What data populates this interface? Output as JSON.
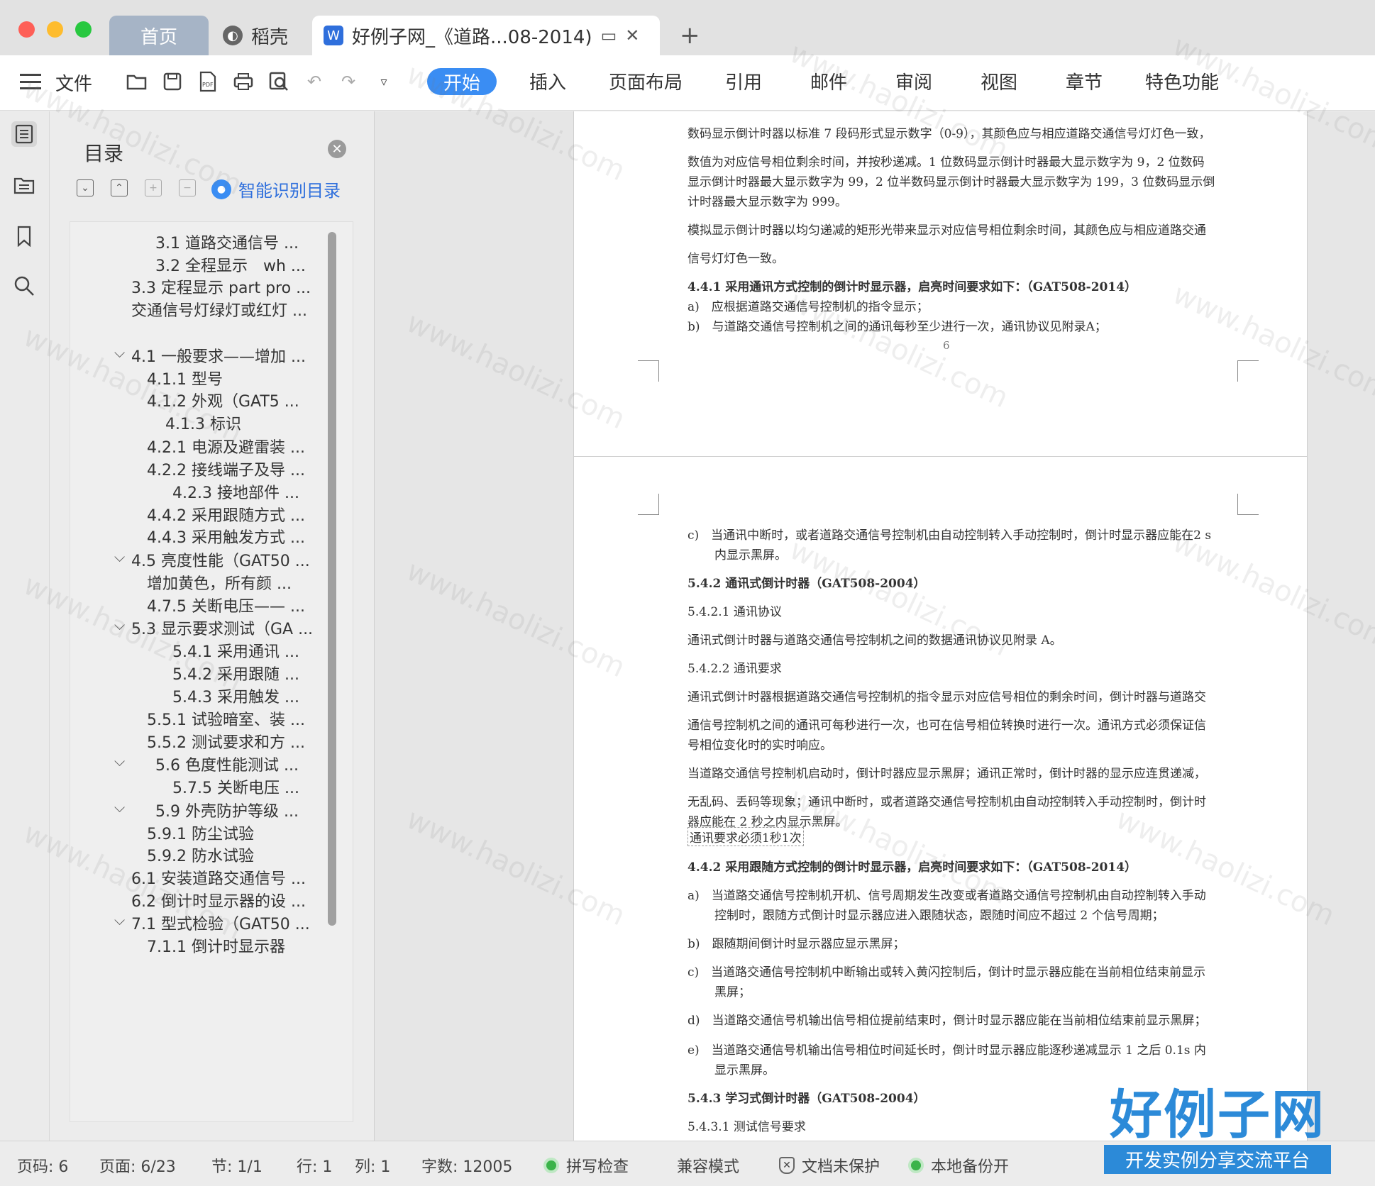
{
  "titlebar": {
    "tabs": [
      {
        "label": "首页"
      },
      {
        "label": "稻壳"
      },
      {
        "label": "好例子网_《道路...08-2014)"
      }
    ],
    "new_tab_label": "+"
  },
  "ribbon": {
    "file_label": "文件",
    "tabs": [
      "开始",
      "插入",
      "页面布局",
      "引用",
      "邮件",
      "审阅",
      "视图",
      "章节",
      "特色功能"
    ]
  },
  "toc": {
    "title": "目录",
    "smart_toc_label": "智能识别目录",
    "items": [
      "3.1 道路交通信号 ...",
      "3.2 全程显示　wh ...",
      "3.3 定程显示 part pro ...",
      "交通信号灯绿灯或红灯 ...",
      "4.1 一般要求——增加 ...",
      "4.1.1 型号",
      "4.1.2 外观（GAT5 ...",
      "4.1.3 标识",
      "4.2.1 电源及避雷装 ...",
      "4.2.2 接线端子及导 ...",
      "4.2.3 接地部件 ...",
      "4.4.2 采用跟随方式 ...",
      "4.4.3 采用触发方式 ...",
      "4.5 亮度性能（GAT50 ...",
      "增加黄色，所有颜 ...",
      "4.7.5 关断电压—— ...",
      "5.3 显示要求测试（GA ...",
      "5.4.1 采用通讯 ...",
      "5.4.2 采用跟随 ...",
      "5.4.3 采用触发 ...",
      "5.5.1 试验暗室、装 ...",
      "5.5.2 测试要求和方 ...",
      "5.6 色度性能测试 ...",
      "5.7.5 关断电压 ...",
      "5.9 外壳防护等级 ...",
      "5.9.1 防尘试验",
      "5.9.2 防水试验",
      "6.1 安装道路交通信号 ...",
      "6.2 倒计时显示器的设 ...",
      "7.1 型式检验（GAT50 ...",
      "7.1.1 倒计时显示器"
    ]
  },
  "page1": {
    "lines": [
      "数码显示倒计时器以标准 7 段码形式显示数字（0-9），其颜色应与相应道路交通信号灯灯色一致，",
      "数值为对应信号相位剩余时间，并按秒递减。1 位数码显示倒计时器最大显示数字为 9，2 位数码",
      "显示倒计时器最大显示数字为 99，2 位半数码显示倒计时器最大显示数字为 199，3 位数码显示倒",
      "计时器最大显示数字为 999。",
      "模拟显示倒计时器以均匀递减的矩形光带来显示对应信号相位剩余时间，其颜色应与相应道路交通",
      "信号灯灯色一致。",
      "4.4.1 采用通讯方式控制的倒计时显示器，启亮时间要求如下：（GAT508-2014）",
      "a)　应根据道路交通信号控制机的指令显示；",
      "b)　与道路交通信号控制机之间的通讯每秒至少进行一次，通讯协议见附录A；"
    ],
    "page_number": "6"
  },
  "page2": {
    "lines": [
      "c)　当通讯中断时，或者道路交通信号控制机由自动控制转入手动控制时，倒计时显示器应能在2 s",
      "内显示黑屏。",
      "5.4.2  通讯式倒计时器（GAT508-2004）",
      "5.4.2.1  通讯协议",
      "通讯式倒计时器与道路交通信号控制机之间的数据通讯协议见附录 A。",
      "5.4.2.2  通讯要求",
      "通讯式倒计时器根据道路交通信号控制机的指令显示对应信号相位的剩余时间，倒计时器与道路交",
      "通信号控制机之间的通讯可每秒进行一次，也可在信号相位转换时进行一次。通讯方式必须保证信",
      "号相位变化时的实时响应。",
      "当道路交通信号控制机启动时，倒计时器应显示黑屏；通讯正常时，倒计时器的显示应连贯递减，",
      "无乱码、丢码等现象；通讯中断时，或者道路交通信号控制机由自动控制转入手动控制时，倒计时",
      "器应能在 2 秒之内显示黑屏。",
      "通讯要求必须1秒1次",
      "4.4.2 采用跟随方式控制的倒计时显示器，启亮时间要求如下：（GAT508-2014）",
      "a)　当道路交通信号控制机开机、信号周期发生改变或者道路交通信号控制机由自动控制转入手动",
      "控制时，跟随方式倒计时显示器应进入跟随状态，跟随时间应不超过 2 个信号周期；",
      "b)　跟随期间倒计时显示器应显示黑屏；",
      "c)　当道路交通信号控制机中断输出或转入黄闪控制后，倒计时显示器应能在当前相位结束前显示",
      "黑屏；",
      "d)　当道路交通信号机输出信号相位提前结束时，倒计时显示器应能在当前相位结束前显示黑屏；",
      "e)　当道路交通信号机输出信号相位时间延长时，倒计时显示器应能逐秒递减显示 1 之后 0.1s 内",
      "显示黑屏。",
      "5.4.3  学习式倒计时器（GAT508-2004）",
      "5.4.3.1  测试信号要求"
    ]
  },
  "statusbar": {
    "page_code": "页码: 6",
    "page": "页面: 6/23",
    "section": "节: 1/1",
    "row": "行: 1",
    "col": "列: 1",
    "word_count": "字数: 12005",
    "spell_check": "拼写检查",
    "compat_mode": "兼容模式",
    "doc_protect": "文档未保护",
    "local_backup": "本地备份开"
  },
  "watermark": {
    "text": "www.haolizi.com",
    "logo_main": "好例子网",
    "logo_sub": "开发实例分享交流平台"
  }
}
